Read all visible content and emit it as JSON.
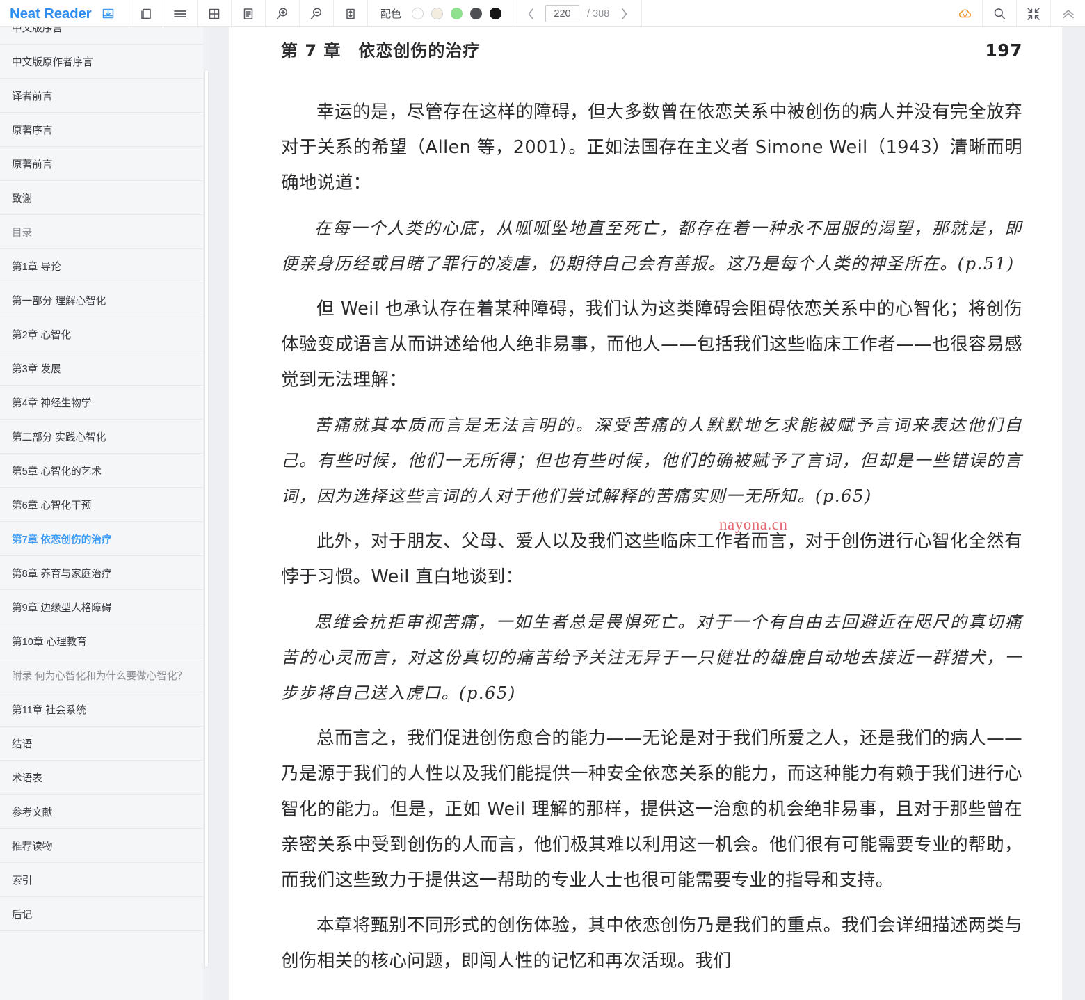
{
  "app": {
    "brand": "Neat Reader"
  },
  "toolbar": {
    "icons": [
      {
        "name": "save-to-library-icon",
        "title": "保存"
      },
      {
        "name": "book-pages-icon",
        "title": "双页"
      },
      {
        "name": "menu-icon",
        "title": "目录"
      },
      {
        "name": "grid-layout-icon",
        "title": "网格"
      },
      {
        "name": "text-document-icon",
        "title": "正文"
      },
      {
        "name": "zoom-in-icon",
        "title": "放大"
      },
      {
        "name": "zoom-out-icon",
        "title": "缩小"
      },
      {
        "name": "line-height-icon",
        "title": "行距"
      }
    ],
    "color_scheme": {
      "label": "配色",
      "swatches": [
        {
          "name": "swatch-white",
          "hex": "#ffffff",
          "selected": false
        },
        {
          "name": "swatch-cream",
          "hex": "#f3eddf",
          "selected": false
        },
        {
          "name": "swatch-green",
          "hex": "#8fe08f",
          "selected": false
        },
        {
          "name": "swatch-gray",
          "hex": "#4d4f53",
          "selected": false
        },
        {
          "name": "swatch-black",
          "hex": "#161616",
          "selected": false
        }
      ]
    },
    "pagination": {
      "prev_label": "‹",
      "next_label": "›",
      "current_page": "220",
      "total_label": "/ 388",
      "total_pages": 388
    },
    "right_icons": [
      {
        "name": "cloud-sync-icon",
        "color": "#f0932b"
      },
      {
        "name": "search-icon",
        "color": "#55575e"
      },
      {
        "name": "fullscreen-exit-icon",
        "color": "#55575e"
      },
      {
        "name": "collapse-up-icon",
        "color": "#8e9096"
      }
    ]
  },
  "sidebar": {
    "items": [
      {
        "label": "中文版序言",
        "state": "normal"
      },
      {
        "label": "中文版原作者序言",
        "state": "normal"
      },
      {
        "label": "译者前言",
        "state": "normal"
      },
      {
        "label": "原著序言",
        "state": "normal"
      },
      {
        "label": "原著前言",
        "state": "normal"
      },
      {
        "label": "致谢",
        "state": "normal"
      },
      {
        "label": "目录",
        "state": "dim"
      },
      {
        "label": "第1章 导论",
        "state": "normal"
      },
      {
        "label": "第一部分 理解心智化",
        "state": "normal"
      },
      {
        "label": "第2章 心智化",
        "state": "normal"
      },
      {
        "label": "第3章 发展",
        "state": "normal"
      },
      {
        "label": "第4章 神经生物学",
        "state": "normal"
      },
      {
        "label": "第二部分 实践心智化",
        "state": "normal"
      },
      {
        "label": "第5章 心智化的艺术",
        "state": "normal"
      },
      {
        "label": "第6章 心智化干预",
        "state": "normal"
      },
      {
        "label": "第7章 依恋创伤的治疗",
        "state": "active"
      },
      {
        "label": "第8章 养育与家庭治疗",
        "state": "normal"
      },
      {
        "label": "第9章 边缘型人格障碍",
        "state": "normal"
      },
      {
        "label": "第10章 心理教育",
        "state": "normal"
      },
      {
        "label": "附录 何为心智化和为什么要做心智化？",
        "state": "dim"
      },
      {
        "label": "第11章 社会系统",
        "state": "normal"
      },
      {
        "label": "结语",
        "state": "normal"
      },
      {
        "label": "术语表",
        "state": "normal"
      },
      {
        "label": "参考文献",
        "state": "normal"
      },
      {
        "label": "推荐读物",
        "state": "normal"
      },
      {
        "label": "索引",
        "state": "normal"
      },
      {
        "label": "后记",
        "state": "normal"
      }
    ]
  },
  "page": {
    "chapter_title": "第 7 章　依恋创伤的治疗",
    "page_number": "197",
    "watermark": "nayona.cn",
    "paragraphs": [
      {
        "style": "body",
        "text": "幸运的是，尽管存在这样的障碍，但大多数曾在依恋关系中被创伤的病人并没有完全放弃对于关系的希望（Allen 等，2001）。正如法国存在主义者 Simone Weil（1943）清晰而明确地说道："
      },
      {
        "style": "quote",
        "text": "在每一个人类的心底，从呱呱坠地直至死亡，都存在着一种永不屈服的渴望，那就是，即便亲身历经或目睹了罪行的凌虐，仍期待自己会有善报。这乃是每个人类的神圣所在。(p.51)"
      },
      {
        "style": "body",
        "text": "但 Weil 也承认存在着某种障碍，我们认为这类障碍会阻碍依恋关系中的心智化；将创伤体验变成语言从而讲述给他人绝非易事，而他人——包括我们这些临床工作者——也很容易感觉到无法理解："
      },
      {
        "style": "quote",
        "text": "苦痛就其本质而言是无法言明的。深受苦痛的人默默地乞求能被赋予言词来表达他们自己。有些时候，他们一无所得；但也有些时候，他们的确被赋予了言词，但却是一些错误的言词，因为选择这些言词的人对于他们尝试解释的苦痛实则一无所知。(p.65)"
      },
      {
        "style": "body",
        "text": "此外，对于朋友、父母、爱人以及我们这些临床工作者而言，对于创伤进行心智化全然有悖于习惯。Weil 直白地谈到："
      },
      {
        "style": "quote",
        "text": "思维会抗拒审视苦痛，一如生者总是畏惧死亡。对于一个有自由去回避近在咫尺的真切痛苦的心灵而言，对这份真切的痛苦给予关注无异于一只健壮的雄鹿自动地去接近一群猎犬，一步步将自己送入虎口。(p.65)"
      },
      {
        "style": "body",
        "text": "总而言之，我们促进创伤愈合的能力——无论是对于我们所爱之人，还是我们的病人——乃是源于我们的人性以及我们能提供一种安全依恋关系的能力，而这种能力有赖于我们进行心智化的能力。但是，正如 Weil 理解的那样，提供这一治愈的机会绝非易事，且对于那些曾在亲密关系中受到创伤的人而言，他们极其难以利用这一机会。他们很有可能需要专业的帮助，而我们这些致力于提供这一帮助的专业人士也很可能需要专业的指导和支持。"
      },
      {
        "style": "body",
        "text": "本章将甄别不同形式的创伤体验，其中依恋创伤乃是我们的重点。我们会详细描述两类与创伤相关的核心问题，即闯人性的记忆和再次活现。我们"
      }
    ]
  }
}
